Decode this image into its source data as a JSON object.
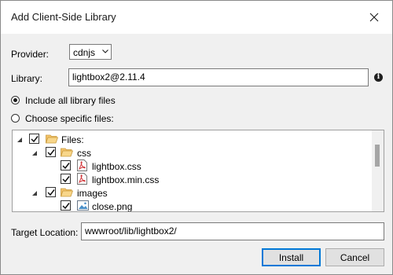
{
  "window": {
    "title": "Add Client-Side Library"
  },
  "provider": {
    "label": "Provider:",
    "value": "cdnjs"
  },
  "library": {
    "label": "Library:",
    "value": "lightbox2@2.11.4"
  },
  "options": {
    "include_all": "Include all library files",
    "choose_specific": "Choose specific files:"
  },
  "tree": {
    "files_label": "Files:",
    "css_label": "css",
    "css_file1": "lightbox.css",
    "css_file2": "lightbox.min.css",
    "images_label": "images",
    "image_file1": "close.png"
  },
  "target": {
    "label": "Target Location:",
    "value": "wwwroot/lib/lightbox2/"
  },
  "buttons": {
    "install": "Install",
    "cancel": "Cancel"
  },
  "colors": {
    "accent": "#0078d7",
    "folder": "#f5c46b",
    "pdf_red": "#d13438"
  }
}
